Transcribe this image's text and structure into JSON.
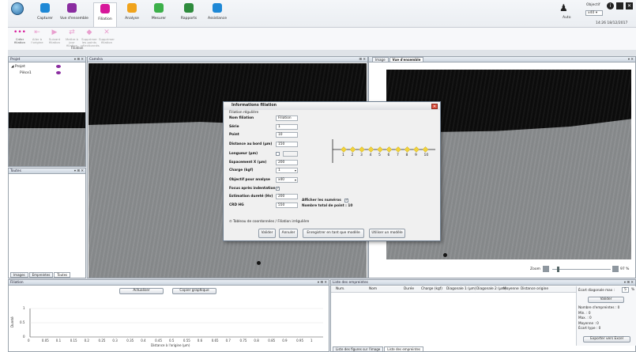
{
  "ribbon": {
    "tabs": [
      {
        "label": "Capturer",
        "icon": "capture-icon",
        "color": "#1e88d6"
      },
      {
        "label": "Vue d'ensemble",
        "icon": "overview-icon",
        "color": "#8a2ca0"
      },
      {
        "label": "Filiation",
        "icon": "filiation-icon",
        "color": "#d7179a"
      },
      {
        "label": "Analyse",
        "icon": "analysis-icon",
        "color": "#f0a31c"
      },
      {
        "label": "Mesurer",
        "icon": "ruler-icon",
        "color": "#3cb04a"
      },
      {
        "label": "Rapports",
        "icon": "report-icon",
        "color": "#2e8b3d"
      },
      {
        "label": "Assistance",
        "icon": "help-icon",
        "color": "#1e88d6"
      }
    ],
    "active_tab": "Filiation",
    "buttons": [
      {
        "l1": "Créer",
        "l2": "filiation",
        "glyph": "•••"
      },
      {
        "l1": "Aller à",
        "l2": "l'origine",
        "glyph": "⇤"
      },
      {
        "l1": "Suivant",
        "l2": "filiation",
        "glyph": "▶"
      },
      {
        "l1": "Mettre à jour",
        "l2": "filiation",
        "glyph": "⇄"
      },
      {
        "l1": "Supprimer les points",
        "l2": "sélectionnés",
        "glyph": "◆"
      },
      {
        "l1": "Supprimer",
        "l2": "filiation",
        "glyph": "✕"
      }
    ],
    "group_label": "Filiation",
    "auto_label": "Auto",
    "objective_label": "Objectif",
    "objective_value": "x40",
    "datetime": "14:26 18/12/2017"
  },
  "projet": {
    "title": "Projet",
    "tree": [
      "Projet",
      "Pièce1"
    ]
  },
  "toutes": {
    "title": "Toutes"
  },
  "left_tabs": [
    "Images",
    "Empreintes",
    "Toutes"
  ],
  "camera": {
    "title": "Caméra"
  },
  "image_panel": {
    "tabs": [
      "Image",
      "Vue d'ensemble"
    ],
    "zoom_label": "Zoom",
    "zoom_value": "97 %"
  },
  "modal": {
    "title": "Informations filiation",
    "mode": "Filiation régulière",
    "fields": [
      {
        "label": "Nom filiation",
        "value": "Filiation"
      },
      {
        "label": "Série",
        "value": "1"
      },
      {
        "label": "Point",
        "value": "10"
      },
      {
        "label": "Distance au bord (µm)",
        "value": "150"
      },
      {
        "label": "Longueur (µm)",
        "value": ""
      },
      {
        "label": "Espacement X (µm)",
        "value": "200"
      },
      {
        "label": "Charge (kgf)",
        "value": "1"
      },
      {
        "label": "Objectif pour analyse",
        "value": "x40"
      },
      {
        "label": "Focus après indentation",
        "value": "✓"
      },
      {
        "label": "Estimation dureté (Hv)",
        "value": "200"
      },
      {
        "label": "CRD HG",
        "value": "550"
      }
    ],
    "show_numbers_label": "Afficher les numéros",
    "total_points_label": "Nombre total de point : 10",
    "points": [
      "1",
      "2",
      "3",
      "4",
      "5",
      "6",
      "7",
      "8",
      "9",
      "10"
    ],
    "expander": "Tableau de coordonnées / Filiation irrégulière",
    "buttons": [
      "Valider",
      "Annuler",
      "Enregistrer en tant que modèle",
      "Utiliser un modèle"
    ]
  },
  "filiation_panel": {
    "title": "Filiation",
    "refresh": "Actualiser",
    "copy_chart": "Copier graphique",
    "ylabel": "Dureté",
    "xlabel": "Distance à l'origine (µm)",
    "yticks": [
      "1",
      "0.5",
      "0"
    ],
    "xticks": [
      "0",
      "0.05",
      "0.1",
      "0.15",
      "0.2",
      "0.25",
      "0.3",
      "0.35",
      "0.4",
      "0.45",
      "0.5",
      "0.55",
      "0.6",
      "0.65",
      "0.7",
      "0.75",
      "0.8",
      "0.85",
      "0.9",
      "0.95",
      "1"
    ]
  },
  "empreintes": {
    "title": "Liste des empreintes",
    "columns": [
      "Num.",
      "Nom",
      "Durée",
      "Charge (kgf)",
      "Diagonale 1 (µm)",
      "Diagonale 2 (µm)",
      "Moyenne",
      "Distance origine"
    ],
    "ecart_label": "Écart diagonale max :",
    "ecart_value": "5",
    "ecart_unit": "%",
    "validate": "Valider",
    "stats": [
      "Nombre d'empreintes : 0",
      "Min. : 0",
      "Max. : 0",
      "Moyenne : 0",
      "Écart type : 0"
    ],
    "export": "Exporter vers Excel",
    "bottom_tabs": [
      "Liste des figures sur l'image",
      "Liste des empreintes"
    ]
  }
}
